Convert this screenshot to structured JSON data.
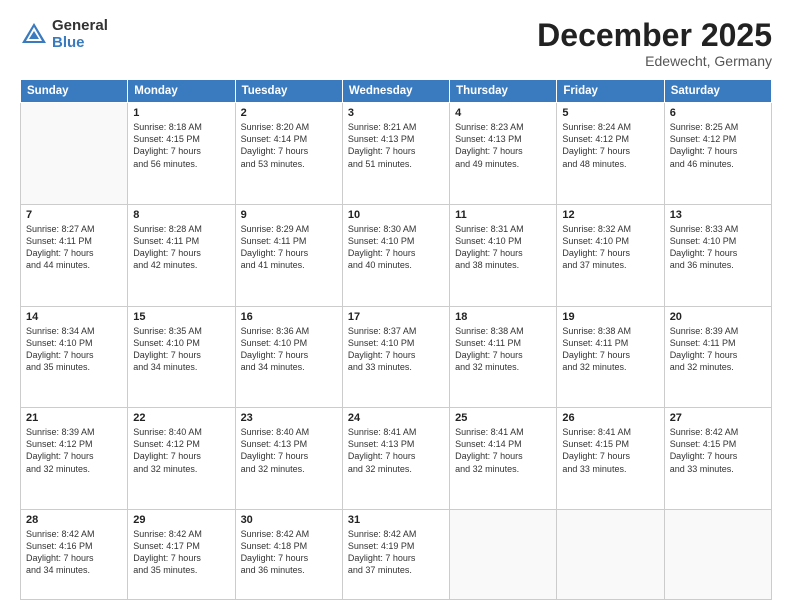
{
  "logo": {
    "general": "General",
    "blue": "Blue"
  },
  "header": {
    "month": "December 2025",
    "location": "Edewecht, Germany"
  },
  "weekdays": [
    "Sunday",
    "Monday",
    "Tuesday",
    "Wednesday",
    "Thursday",
    "Friday",
    "Saturday"
  ],
  "weeks": [
    [
      {
        "day": "",
        "sunrise": "",
        "sunset": "",
        "daylight": ""
      },
      {
        "day": "1",
        "sunrise": "Sunrise: 8:18 AM",
        "sunset": "Sunset: 4:15 PM",
        "daylight": "Daylight: 7 hours and 56 minutes."
      },
      {
        "day": "2",
        "sunrise": "Sunrise: 8:20 AM",
        "sunset": "Sunset: 4:14 PM",
        "daylight": "Daylight: 7 hours and 53 minutes."
      },
      {
        "day": "3",
        "sunrise": "Sunrise: 8:21 AM",
        "sunset": "Sunset: 4:13 PM",
        "daylight": "Daylight: 7 hours and 51 minutes."
      },
      {
        "day": "4",
        "sunrise": "Sunrise: 8:23 AM",
        "sunset": "Sunset: 4:13 PM",
        "daylight": "Daylight: 7 hours and 49 minutes."
      },
      {
        "day": "5",
        "sunrise": "Sunrise: 8:24 AM",
        "sunset": "Sunset: 4:12 PM",
        "daylight": "Daylight: 7 hours and 48 minutes."
      },
      {
        "day": "6",
        "sunrise": "Sunrise: 8:25 AM",
        "sunset": "Sunset: 4:12 PM",
        "daylight": "Daylight: 7 hours and 46 minutes."
      }
    ],
    [
      {
        "day": "7",
        "sunrise": "Sunrise: 8:27 AM",
        "sunset": "Sunset: 4:11 PM",
        "daylight": "Daylight: 7 hours and 44 minutes."
      },
      {
        "day": "8",
        "sunrise": "Sunrise: 8:28 AM",
        "sunset": "Sunset: 4:11 PM",
        "daylight": "Daylight: 7 hours and 42 minutes."
      },
      {
        "day": "9",
        "sunrise": "Sunrise: 8:29 AM",
        "sunset": "Sunset: 4:11 PM",
        "daylight": "Daylight: 7 hours and 41 minutes."
      },
      {
        "day": "10",
        "sunrise": "Sunrise: 8:30 AM",
        "sunset": "Sunset: 4:10 PM",
        "daylight": "Daylight: 7 hours and 40 minutes."
      },
      {
        "day": "11",
        "sunrise": "Sunrise: 8:31 AM",
        "sunset": "Sunset: 4:10 PM",
        "daylight": "Daylight: 7 hours and 38 minutes."
      },
      {
        "day": "12",
        "sunrise": "Sunrise: 8:32 AM",
        "sunset": "Sunset: 4:10 PM",
        "daylight": "Daylight: 7 hours and 37 minutes."
      },
      {
        "day": "13",
        "sunrise": "Sunrise: 8:33 AM",
        "sunset": "Sunset: 4:10 PM",
        "daylight": "Daylight: 7 hours and 36 minutes."
      }
    ],
    [
      {
        "day": "14",
        "sunrise": "Sunrise: 8:34 AM",
        "sunset": "Sunset: 4:10 PM",
        "daylight": "Daylight: 7 hours and 35 minutes."
      },
      {
        "day": "15",
        "sunrise": "Sunrise: 8:35 AM",
        "sunset": "Sunset: 4:10 PM",
        "daylight": "Daylight: 7 hours and 34 minutes."
      },
      {
        "day": "16",
        "sunrise": "Sunrise: 8:36 AM",
        "sunset": "Sunset: 4:10 PM",
        "daylight": "Daylight: 7 hours and 34 minutes."
      },
      {
        "day": "17",
        "sunrise": "Sunrise: 8:37 AM",
        "sunset": "Sunset: 4:10 PM",
        "daylight": "Daylight: 7 hours and 33 minutes."
      },
      {
        "day": "18",
        "sunrise": "Sunrise: 8:38 AM",
        "sunset": "Sunset: 4:11 PM",
        "daylight": "Daylight: 7 hours and 32 minutes."
      },
      {
        "day": "19",
        "sunrise": "Sunrise: 8:38 AM",
        "sunset": "Sunset: 4:11 PM",
        "daylight": "Daylight: 7 hours and 32 minutes."
      },
      {
        "day": "20",
        "sunrise": "Sunrise: 8:39 AM",
        "sunset": "Sunset: 4:11 PM",
        "daylight": "Daylight: 7 hours and 32 minutes."
      }
    ],
    [
      {
        "day": "21",
        "sunrise": "Sunrise: 8:39 AM",
        "sunset": "Sunset: 4:12 PM",
        "daylight": "Daylight: 7 hours and 32 minutes."
      },
      {
        "day": "22",
        "sunrise": "Sunrise: 8:40 AM",
        "sunset": "Sunset: 4:12 PM",
        "daylight": "Daylight: 7 hours and 32 minutes."
      },
      {
        "day": "23",
        "sunrise": "Sunrise: 8:40 AM",
        "sunset": "Sunset: 4:13 PM",
        "daylight": "Daylight: 7 hours and 32 minutes."
      },
      {
        "day": "24",
        "sunrise": "Sunrise: 8:41 AM",
        "sunset": "Sunset: 4:13 PM",
        "daylight": "Daylight: 7 hours and 32 minutes."
      },
      {
        "day": "25",
        "sunrise": "Sunrise: 8:41 AM",
        "sunset": "Sunset: 4:14 PM",
        "daylight": "Daylight: 7 hours and 32 minutes."
      },
      {
        "day": "26",
        "sunrise": "Sunrise: 8:41 AM",
        "sunset": "Sunset: 4:15 PM",
        "daylight": "Daylight: 7 hours and 33 minutes."
      },
      {
        "day": "27",
        "sunrise": "Sunrise: 8:42 AM",
        "sunset": "Sunset: 4:15 PM",
        "daylight": "Daylight: 7 hours and 33 minutes."
      }
    ],
    [
      {
        "day": "28",
        "sunrise": "Sunrise: 8:42 AM",
        "sunset": "Sunset: 4:16 PM",
        "daylight": "Daylight: 7 hours and 34 minutes."
      },
      {
        "day": "29",
        "sunrise": "Sunrise: 8:42 AM",
        "sunset": "Sunset: 4:17 PM",
        "daylight": "Daylight: 7 hours and 35 minutes."
      },
      {
        "day": "30",
        "sunrise": "Sunrise: 8:42 AM",
        "sunset": "Sunset: 4:18 PM",
        "daylight": "Daylight: 7 hours and 36 minutes."
      },
      {
        "day": "31",
        "sunrise": "Sunrise: 8:42 AM",
        "sunset": "Sunset: 4:19 PM",
        "daylight": "Daylight: 7 hours and 37 minutes."
      },
      {
        "day": "",
        "sunrise": "",
        "sunset": "",
        "daylight": ""
      },
      {
        "day": "",
        "sunrise": "",
        "sunset": "",
        "daylight": ""
      },
      {
        "day": "",
        "sunrise": "",
        "sunset": "",
        "daylight": ""
      }
    ]
  ]
}
